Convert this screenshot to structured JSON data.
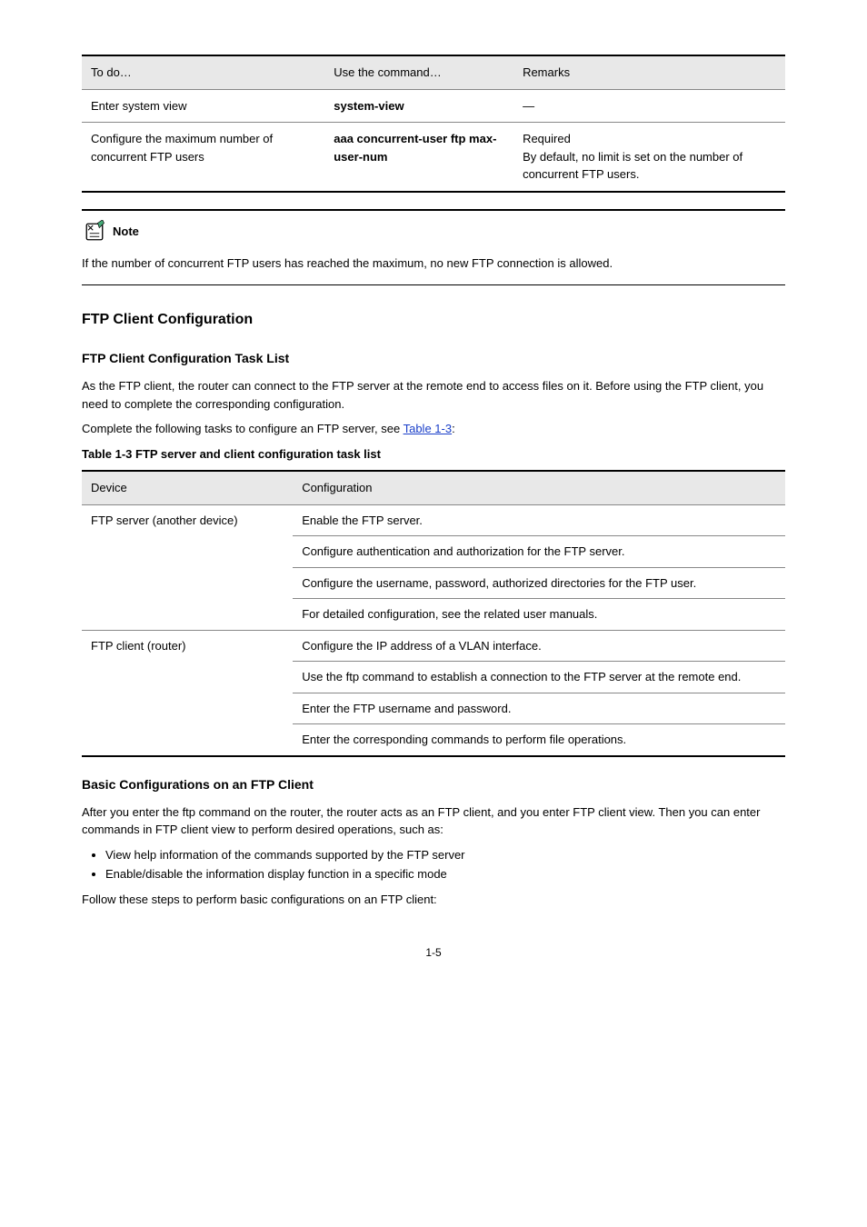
{
  "table1": {
    "headers": [
      "To do…",
      "Use the command…",
      "Remarks"
    ],
    "rows": [
      {
        "c0": "Enter system view",
        "c1": "system-view",
        "c2": "—"
      },
      {
        "c0": "Configure the maximum number of concurrent FTP users",
        "c1": "aaa concurrent-user ftp max-user-num",
        "c2": "Required\nBy default, no limit is set on the number of concurrent FTP users."
      }
    ]
  },
  "note": {
    "label": "Note",
    "text": "If the number of concurrent FTP users has reached the maximum, no new FTP connection is allowed."
  },
  "sec_heading": "FTP Client Configuration",
  "sub_heading": "FTP Client Configuration Task List",
  "para1": "As the FTP client, the router can connect to the FTP server at the remote end to access files on it. Before using the FTP client, you need to complete the corresponding configuration.",
  "para2_a": "Complete the following tasks to configure an FTP server, see ",
  "para2_link": "Table 1-3",
  "para2_b": ":",
  "table2_caption": "Table 1-3 FTP server and client configuration task list",
  "table2": {
    "headers": [
      "Device",
      "Configuration"
    ],
    "groups": [
      {
        "device": "FTP server (another device)",
        "rows": [
          "Enable the FTP server.",
          "Configure authentication and authorization for the FTP server.",
          "Configure the username, password, authorized directories for the FTP user.",
          "For detailed configuration, see the related user manuals."
        ]
      },
      {
        "device": "FTP client (router)",
        "rows": [
          "Configure the IP address of a VLAN interface.",
          "Use the ftp command to establish a connection to the FTP server at the remote end.",
          "Enter the FTP username and password.",
          "Enter the corresponding commands to perform file operations."
        ]
      }
    ]
  },
  "bconf_heading": "Basic Configurations on an FTP Client",
  "bconf_para": "After you enter the ftp command on the router, the router acts as an FTP client, and you enter FTP client view. Then you can enter commands in FTP client view to perform desired operations, such as:",
  "bullets": [
    "View help information of the commands supported by the FTP server",
    "Enable/disable the information display function in a specific mode"
  ],
  "bconf_follow": "Follow these steps to perform basic configurations on an FTP client:",
  "pagenum": "1-5"
}
